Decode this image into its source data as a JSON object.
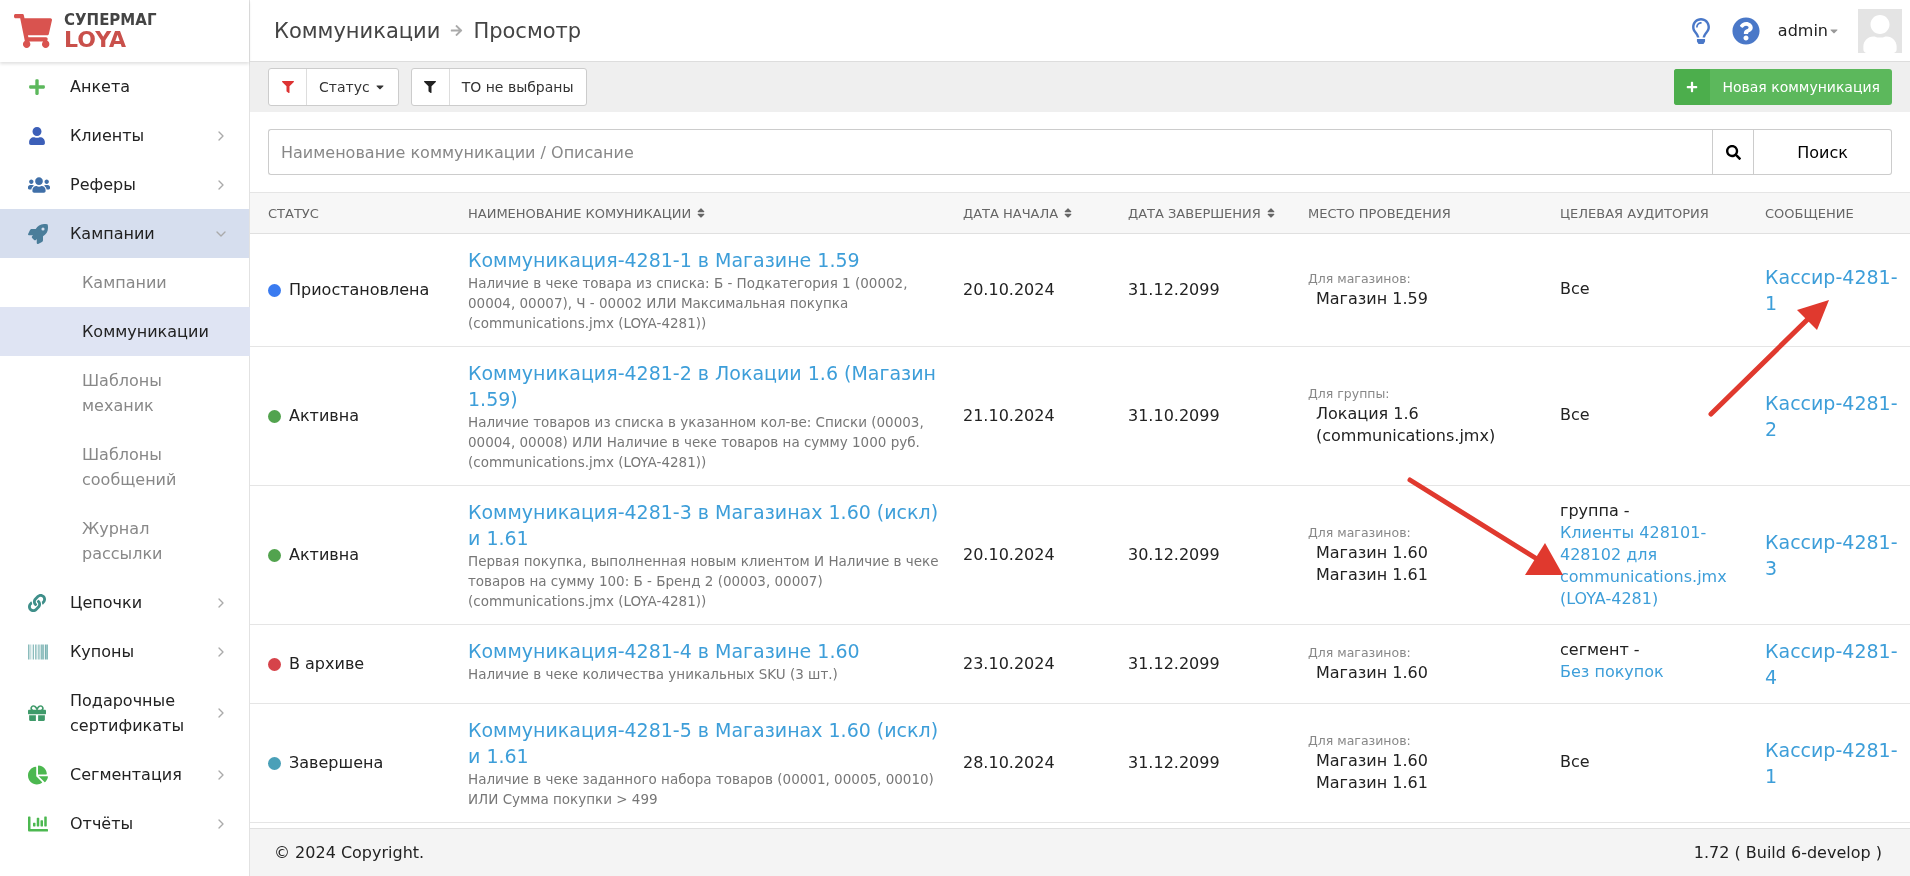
{
  "brand": {
    "line1": "СУПЕРМАГ",
    "line2": "LOYA"
  },
  "sidebar": {
    "items": [
      {
        "label": "Анкета",
        "kind": "link"
      },
      {
        "label": "Клиенты",
        "kind": "group",
        "expanded": false
      },
      {
        "label": "Реферы",
        "kind": "group",
        "expanded": false
      },
      {
        "label": "Кампании",
        "kind": "group",
        "expanded": true,
        "selected": true,
        "children": [
          {
            "label": "Кампании",
            "selected": false
          },
          {
            "label": "Коммуникации",
            "selected": true
          },
          {
            "label": "Шаблоны механик",
            "selected": false
          },
          {
            "label": "Шаблоны сообщений",
            "selected": false
          },
          {
            "label": "Журнал рассылки",
            "selected": false
          }
        ]
      },
      {
        "label": "Цепочки",
        "kind": "group",
        "expanded": false
      },
      {
        "label": "Купоны",
        "kind": "group",
        "expanded": false
      },
      {
        "label": "Подарочные сертификаты",
        "kind": "group",
        "expanded": false
      },
      {
        "label": "Сегментация",
        "kind": "group",
        "expanded": false
      },
      {
        "label": "Отчёты",
        "kind": "group",
        "expanded": false
      }
    ]
  },
  "header": {
    "breadcrumb": [
      "Коммуникации",
      "Просмотр"
    ],
    "user": "admin"
  },
  "toolbar": {
    "filters": [
      {
        "label": "Статус",
        "kind": "dropdown",
        "active": true
      },
      {
        "label": "ТО не выбраны",
        "kind": "plain",
        "active": false
      }
    ],
    "new_button": "Новая коммуникация"
  },
  "search": {
    "placeholder": "Наименование коммуникации / Описание",
    "button": "Поиск"
  },
  "table": {
    "columns": [
      {
        "label": "СТАТУС",
        "sortable": false
      },
      {
        "label": "НАИМЕНОВАНИЕ КОМУНИКАЦИИ",
        "sortable": true
      },
      {
        "label": "ДАТА НАЧАЛА",
        "sortable": true
      },
      {
        "label": "ДАТА ЗАВЕРШЕНИЯ",
        "sortable": true
      },
      {
        "label": "МЕСТО ПРОВЕДЕНИЯ",
        "sortable": false
      },
      {
        "label": "ЦЕЛЕВАЯ АУДИТОРИЯ",
        "sortable": false
      },
      {
        "label": "СООБЩЕНИЕ",
        "sortable": false
      }
    ],
    "rows": [
      {
        "status": "Приостановлена",
        "color": "#3a7bf0",
        "title": "Коммуникация-4281-1 в Магазине 1.59",
        "description": "Наличие в чеке товара из списка: Б - Подкатегория 1 (00002, 00004, 00007), Ч - 00002 ИЛИ Максимальная покупка (communications.jmx (LOYA-4281))",
        "start": "20.10.2024",
        "end": "31.12.2099",
        "place_label": "Для магазинов:",
        "places": [
          "Магазин 1.59"
        ],
        "audience": {
          "text": "Все"
        },
        "message": "Кассир-4281-1"
      },
      {
        "status": "Активна",
        "color": "#52a34e",
        "title": "Коммуникация-4281-2 в Локации 1.6 (Магазин 1.59)",
        "description": "Наличие товаров из списка в указанном кол-ве: Списки (00003, 00004, 00008) ИЛИ Наличие в чеке товаров на сумму 1000 руб. (communications.jmx (LOYA-4281))",
        "start": "21.10.2024",
        "end": "31.10.2099",
        "place_label": "Для группы:",
        "places": [
          "Локация 1.6 (communications.jmx)"
        ],
        "audience": {
          "text": "Все"
        },
        "message": "Кассир-4281-2"
      },
      {
        "status": "Активна",
        "color": "#52a34e",
        "title": "Коммуникация-4281-3 в Магазинах 1.60 (искл) и 1.61",
        "description": "Первая покупка, выполненная новым клиентом И Наличие в чеке товаров на сумму 100: Б - Бренд 2 (00003, 00007) (communications.jmx (LOYA-4281))",
        "start": "20.10.2024",
        "end": "30.12.2099",
        "place_label": "Для магазинов:",
        "places": [
          "Магазин 1.60",
          "Магазин 1.61"
        ],
        "audience": {
          "text": "группа -",
          "link": "Клиенты 428101-428102 для communications.jmx (LOYA-4281)"
        },
        "message": "Кассир-4281-3"
      },
      {
        "status": "В архиве",
        "color": "#d6434a",
        "title": "Коммуникация-4281-4 в Магазине 1.60",
        "description": "Наличие в чеке количества уникальных SKU (3 шт.)",
        "start": "23.10.2024",
        "end": "31.12.2099",
        "place_label": "Для магазинов:",
        "places": [
          "Магазин 1.60"
        ],
        "audience": {
          "text": "сегмент -",
          "link": "Без покупок"
        },
        "message": "Кассир-4281-4"
      },
      {
        "status": "Завершена",
        "color": "#4aa0b8",
        "title": "Коммуникация-4281-5 в Магазинах 1.60 (искл) и 1.61",
        "description": "Наличие в чеке заданного набора товаров (00001, 00005, 00010) ИЛИ Сумма покупки > 499",
        "start": "28.10.2024",
        "end": "31.12.2099",
        "place_label": "Для магазинов:",
        "places": [
          "Магазин 1.60",
          "Магазин 1.61"
        ],
        "audience": {
          "text": "Все"
        },
        "message": "Кассир-4281-1"
      }
    ]
  },
  "footer": {
    "copyright": "© 2024 Copyright.",
    "version": "1.72 ( Build 6-develop )"
  }
}
